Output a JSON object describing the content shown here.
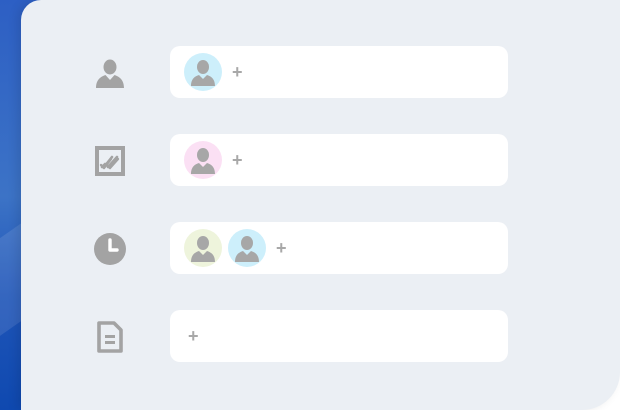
{
  "rows": [
    {
      "icon": "person-icon",
      "avatars": [
        {
          "color": "#cdeffb"
        }
      ],
      "add_label": "+"
    },
    {
      "icon": "checked-chart-icon",
      "avatars": [
        {
          "color": "#fbe0f4"
        }
      ],
      "add_label": "+"
    },
    {
      "icon": "clock-icon",
      "avatars": [
        {
          "color": "#eef4dc"
        },
        {
          "color": "#cdeffb"
        }
      ],
      "add_label": "+"
    },
    {
      "icon": "document-icon",
      "avatars": [],
      "add_label": "+"
    }
  ],
  "colors": {
    "panel_bg": "#ebeff4",
    "card_bg": "#ffffff",
    "icon_gray": "#a3a3a3",
    "accent_blue": "#2d5fc4"
  }
}
